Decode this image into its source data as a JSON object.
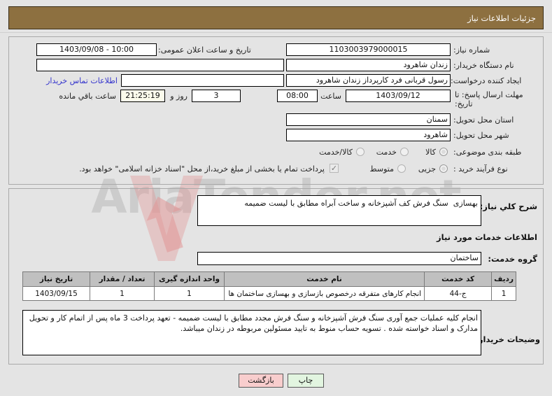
{
  "window": {
    "title": "جزئیات اطلاعات نیاز",
    "header_color": "#8d7040",
    "page_bg": "#e4e4e4"
  },
  "watermark": {
    "text": "AriaTender.net",
    "logo_icon": "arrow-down-logo-icon",
    "color": "#787878"
  },
  "form": {
    "need_number": {
      "label": "شماره نیاز:",
      "value": "1103003979000015"
    },
    "public_announce": {
      "label": "تاریخ و ساعت اعلان عمومی:",
      "value": "10:00 - 1403/09/08"
    },
    "buyer_org": {
      "label": "نام دستگاه خریدار:",
      "value": "زندان شاهرود",
      "extra_value": ""
    },
    "requester": {
      "label": "ایجاد کننده درخواست:",
      "value": "رسول قربانی فرد کارپرداز زندان شاهرود"
    },
    "buyer_contact_link": {
      "label": "اطلاعات تماس خریدار",
      "value": ""
    },
    "deadline": {
      "label": "مهلت ارسال پاسخ: تا تاریخ:",
      "date": "1403/09/12",
      "time_label": "ساعت",
      "time": "08:00",
      "days": "3",
      "days_unit_label": "روز و",
      "countdown": "21:25:19",
      "countdown_label": "ساعت باقي مانده"
    },
    "province": {
      "label": "استان محل تحویل:",
      "value": "سمنان"
    },
    "city": {
      "label": "شهر محل تحویل:",
      "value": "شاهرود"
    },
    "classification": {
      "label": "طبقه بندی موضوعی:",
      "options": [
        {
          "label": "کالا",
          "selected": false
        },
        {
          "label": "خدمت",
          "selected": true
        },
        {
          "label": "کالا/خدمت",
          "selected": false
        }
      ]
    },
    "purchase_process": {
      "label": "نوع فرآیند خرید :",
      "options": [
        {
          "label": "جزیی",
          "selected": true
        },
        {
          "label": "متوسط",
          "selected": false
        }
      ],
      "checkbox": {
        "checked": true,
        "icon": "check-icon"
      },
      "checkbox_note": "پرداخت تمام یا بخشی از مبلغ خرید،از محل \"اسناد خزانه اسلامی\" خواهد بود."
    }
  },
  "need_summary": {
    "label": "شرح کلي نیاز:",
    "value": "بهسازی  سنگ فرش کف آشپزخانه و ساخت آبراه مطابق با لیست ضمیمه"
  },
  "services_section": {
    "heading": "اطلاعات خدمات مورد نیاز",
    "group": {
      "label": "گروه خدمت:",
      "value": "ساختمان"
    }
  },
  "table": {
    "headers": [
      "ردیف",
      "کد خدمت",
      "نام خدمت",
      "واحد اندازه گیری",
      "تعداد / مقدار",
      "تاریخ نیاز"
    ],
    "rows": [
      {
        "row_no": "1",
        "service_code": "ج-44",
        "service_name": "انجام کارهای متفرقه درخصوص بازسازی و بهسازی ساختمان ها",
        "unit": "1",
        "quantity": "1",
        "need_date": "1403/09/15"
      }
    ]
  },
  "buyer_notes": {
    "label": "وضیحات خریدار:",
    "value": "انجام کلیه عملیات جمع آوری سنگ فرش آشپزخانه و سنگ فرش مجدد مطابق با لیست ضمیمه - تعهد پرداخت 3 ماه پس از اتمام کار و تحویل مدارک و اسناد خواسته شده . تسویه حساب منوط به تایید مسئولین مربوطه در زندان میباشد."
  },
  "buttons": {
    "back": {
      "label": "بازگشت",
      "color": "#f8cdcd"
    },
    "print": {
      "label": "چاپ",
      "color": "#e2f5e0"
    }
  }
}
